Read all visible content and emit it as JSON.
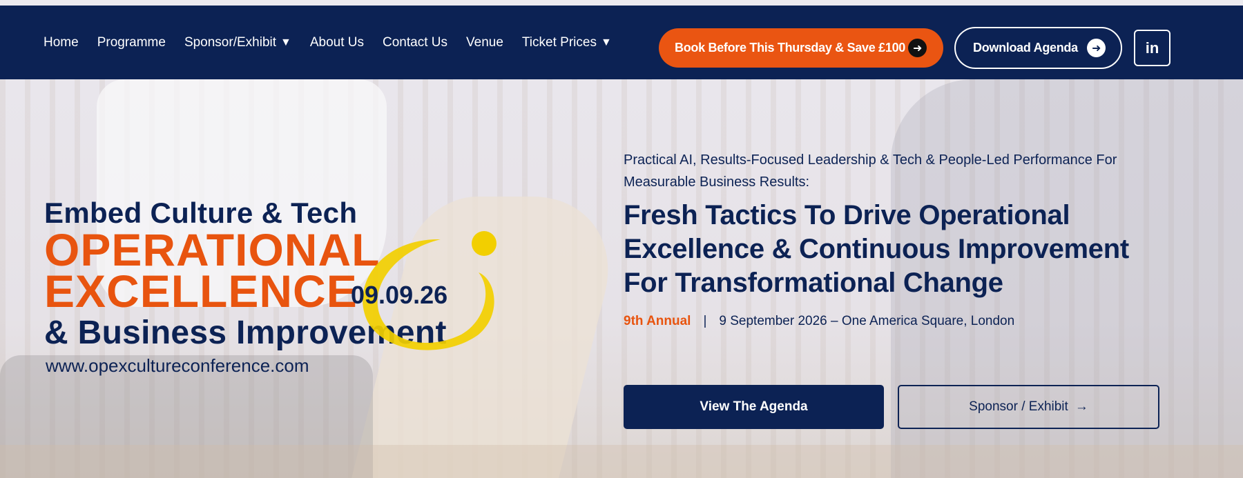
{
  "nav": {
    "items": [
      {
        "label": "Home",
        "has_caret": false
      },
      {
        "label": "Programme",
        "has_caret": false
      },
      {
        "label": "Sponsor/Exhibit",
        "has_caret": true
      },
      {
        "label": "About Us",
        "has_caret": false
      },
      {
        "label": "Contact Us",
        "has_caret": false
      },
      {
        "label": "Venue",
        "has_caret": false
      },
      {
        "label": "Ticket Prices",
        "has_caret": true
      }
    ],
    "caret_glyph": "▼",
    "book_button": {
      "label": "Book Before This Thursday & Save £100",
      "icon": "arrow-right-icon",
      "glyph": "➜"
    },
    "agenda_button": {
      "label": "Download Agenda",
      "icon": "arrow-right-icon",
      "glyph": "➜"
    },
    "linkedin": {
      "label": "in",
      "icon": "linkedin-icon"
    }
  },
  "logo": {
    "line1": "Embed Culture & Tech",
    "line2": "OPERATIONAL",
    "line3": "EXCELLENCE",
    "line4": "& Business Improvement",
    "date": "09.09.26",
    "url": "www.opexcultureconference.com"
  },
  "hero": {
    "kicker": "Practical AI, Results-Focused Leadership & Tech & People-Led Performance For Measurable Business Results:",
    "headline": "Fresh Tactics To Drive Operational Excellence & Continuous Improvement For Transformational Change",
    "annual": "9th Annual",
    "separator": "|",
    "event_details": "9 September 2026 – One America Square, London",
    "primary_button": "View The Agenda",
    "secondary_button": "Sponsor / Exhibit",
    "secondary_arrow": "→"
  },
  "colors": {
    "navy": "#0c2254",
    "orange": "#e8540f",
    "yellow": "#f2cf00"
  }
}
